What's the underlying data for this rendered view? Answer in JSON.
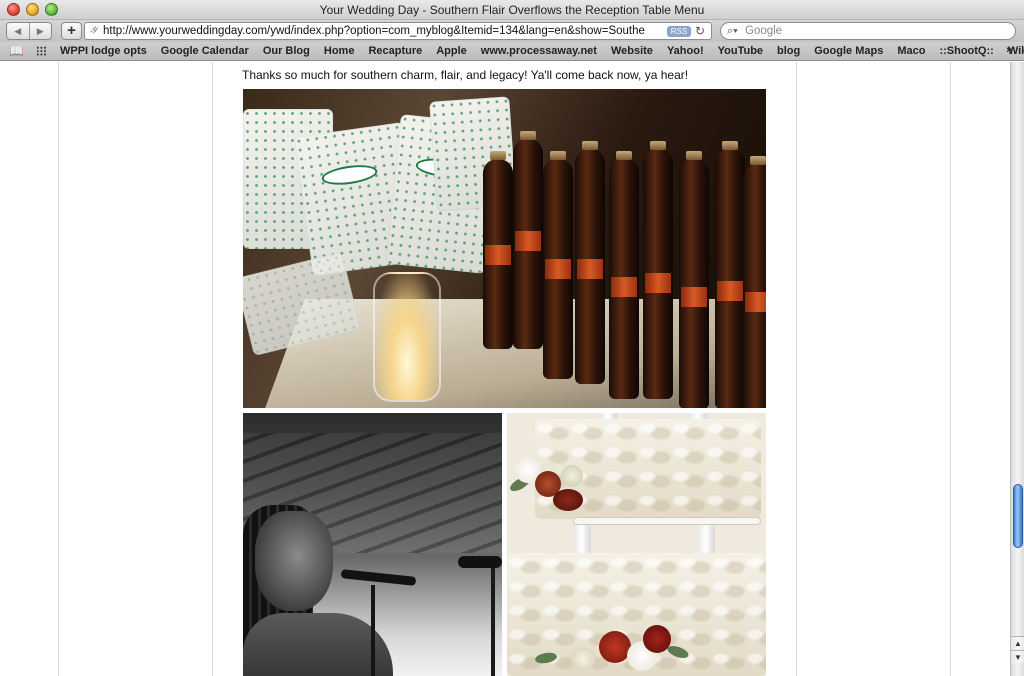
{
  "window": {
    "title": "Your Wedding Day - Southern Flair Overflows the Reception Table Menu"
  },
  "toolbar": {
    "back_icon": "◀",
    "forward_icon": "▶",
    "add_icon": "+",
    "url": "http://www.yourweddingday.com/ywd/index.php?option=com_myblog&Itemid=134&lang=en&show=Southe",
    "rss_label": "RSS",
    "reload_icon": "↻",
    "search_placeholder": "Google",
    "search_icon": "🔍"
  },
  "bookmarks": {
    "items": [
      "WPPI lodge opts",
      "Google Calendar",
      "Our Blog",
      "Home",
      "Recapture",
      "Apple",
      "www.processaway.net",
      "Website",
      "Yahoo!",
      "YouTube",
      "blog",
      "Google Maps",
      "Maco",
      "::ShootQ::",
      "Wikipedia"
    ],
    "more_icon": "»"
  },
  "content": {
    "intro_text": "Thanks so much for southern charm, flair, and legacy!  Ya'll come back now, ya hear!",
    "photos": [
      {
        "name": "doughnuts-and-cola-photo"
      },
      {
        "name": "singer-photo"
      },
      {
        "name": "wedding-cake-photo"
      }
    ]
  },
  "colors": {
    "accent": "#3f7fd8",
    "rss_badge": "#8fa4c4"
  }
}
